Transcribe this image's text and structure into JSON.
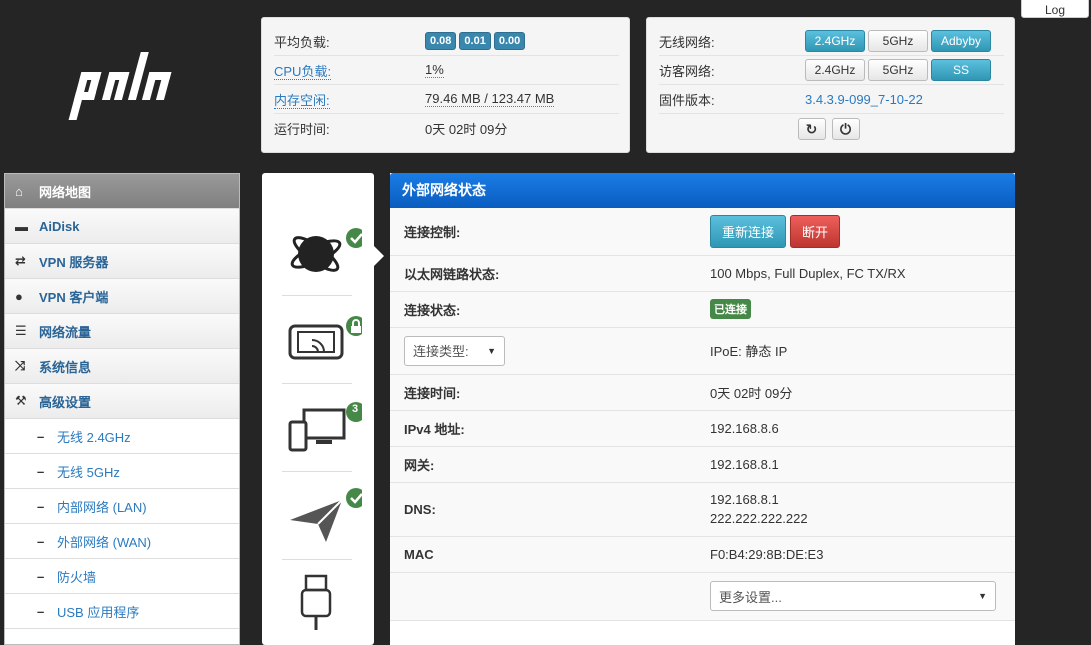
{
  "header": {
    "logo_text": "padavan",
    "log_label": "Log"
  },
  "status": {
    "load_label": "平均负载:",
    "load_values": [
      "0.08",
      "0.01",
      "0.00"
    ],
    "cpu_label": "CPU负载:",
    "cpu_value": "1%",
    "mem_label": "内存空闲:",
    "mem_value": "79.46 MB / 123.47 MB",
    "uptime_label": "运行时间:",
    "uptime_value": "0天 02时 09分"
  },
  "wireless": {
    "wifi_label": "无线网络:",
    "wifi_buttons": [
      "2.4GHz",
      "5GHz",
      "Adbyby"
    ],
    "guest_label": "访客网络:",
    "guest_buttons": [
      "2.4GHz",
      "5GHz",
      "SS"
    ],
    "firmware_label": "固件版本:",
    "firmware_value": "3.4.3.9-099_7-10-22"
  },
  "sidebar": {
    "items": [
      {
        "label": "网络地图",
        "icon": "home-icon"
      },
      {
        "label": "AiDisk",
        "icon": "hdd-icon"
      },
      {
        "label": "VPN 服务器",
        "icon": "retweet-icon"
      },
      {
        "label": "VPN 客户端",
        "icon": "globe-icon"
      },
      {
        "label": "网络流量",
        "icon": "list-icon"
      },
      {
        "label": "系统信息",
        "icon": "random-icon"
      },
      {
        "label": "高级设置",
        "icon": "wrench-icon"
      }
    ],
    "sub_items": [
      "无线 2.4GHz",
      "无线 5GHz",
      "内部网络 (LAN)",
      "外部网络 (WAN)",
      "防火墙",
      "USB 应用程序"
    ]
  },
  "iconcol": {
    "clients_count": "3"
  },
  "wan": {
    "title": "外部网络状态",
    "control_label": "连接控制:",
    "reconnect_label": "重新连接",
    "disconnect_label": "断开",
    "eth_label": "以太网链路状态:",
    "eth_value": "100 Mbps, Full Duplex, FC TX/RX",
    "conn_label": "连接状态:",
    "conn_value": "已连接",
    "type_select": "连接类型:",
    "type_value": "IPoE: 静态 IP",
    "time_label": "连接时间:",
    "time_value": "0天 02时 09分",
    "ipv4_label": "IPv4 地址:",
    "ipv4_value": "192.168.8.6",
    "gw_label": "网关:",
    "gw_value": "192.168.8.1",
    "dns_label": "DNS:",
    "dns_values": [
      "192.168.8.1",
      "222.222.222.222"
    ],
    "mac_label": "MAC",
    "mac_value": "F0:B4:29:8B:DE:E3",
    "more_select": "更多设置..."
  },
  "colors": {
    "accent": "#2f96b4",
    "header_blue": "#0a5cbf",
    "success": "#468847",
    "danger": "#bd362f"
  }
}
